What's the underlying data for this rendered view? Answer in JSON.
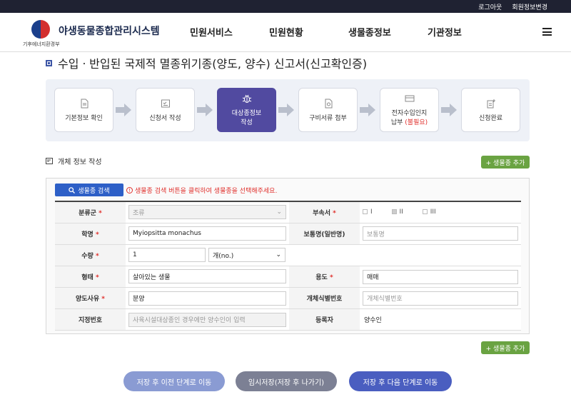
{
  "topbar": {
    "logout": "로그아웃",
    "edit_info": "회원정보변경"
  },
  "header": {
    "logo_title": "야생동물종합관리시스템",
    "logo_gov": "기후에너지환경부",
    "nav": [
      "민원서비스",
      "민원현황",
      "생물종정보",
      "기관정보"
    ]
  },
  "page": {
    "title": "수입ㆍ반입된 국제적 멸종위기종(양도, 양수) 신고서(신고확인증)"
  },
  "steps": [
    {
      "line1": "기본정보 확인",
      "line2": ""
    },
    {
      "line1": "신청서 작성",
      "line2": ""
    },
    {
      "line1": "대상종정보",
      "line2": "작성"
    },
    {
      "line1": "구비서류 첨부",
      "line2": ""
    },
    {
      "line1": "전자수입인지",
      "line2": "납부",
      "extra": "(불필요)"
    },
    {
      "line1": "신청완료",
      "line2": ""
    }
  ],
  "section": {
    "title": "개체 정보 작성",
    "add_species": "+ 생물종 추가"
  },
  "form": {
    "search_button": "생물종 검색",
    "hint": "생물종 검색 버튼을 클릭하여 생물종을 선택해주세요.",
    "labels": {
      "category": "분류군",
      "appendix": "부속서",
      "sci_name": "학명",
      "common_name": "보통명(일반명)",
      "quantity": "수량",
      "form": "형태",
      "purpose": "용도",
      "transfer_reason": "양도사유",
      "individual_id": "개체식별번호",
      "designation_no": "지정번호",
      "registrant": "등록자"
    },
    "required_mark": "*",
    "values": {
      "category": "조류",
      "appendix_options": [
        "I",
        "II",
        "III"
      ],
      "sci_name": "Myiopsitta monachus",
      "common_name_placeholder": "보통명",
      "quantity": "1",
      "unit": "개(no.)",
      "form": "살아있는 생물",
      "purpose": "매매",
      "transfer_reason": "분양",
      "individual_id_placeholder": "개체식별번호",
      "designation_placeholder": "사육시설대상종인 경우에만 양수인이 입력",
      "registrant": "양수인"
    }
  },
  "buttons": {
    "prev": "저장 후 이전 단계로 이동",
    "temp": "임시저장(저장 후 나가기)",
    "next": "저장 후 다음 단계로 이동"
  },
  "colors": {
    "active_step": "#514aa0",
    "green": "#6aa342",
    "primary": "#2d5fc7",
    "required": "#e0302c"
  }
}
